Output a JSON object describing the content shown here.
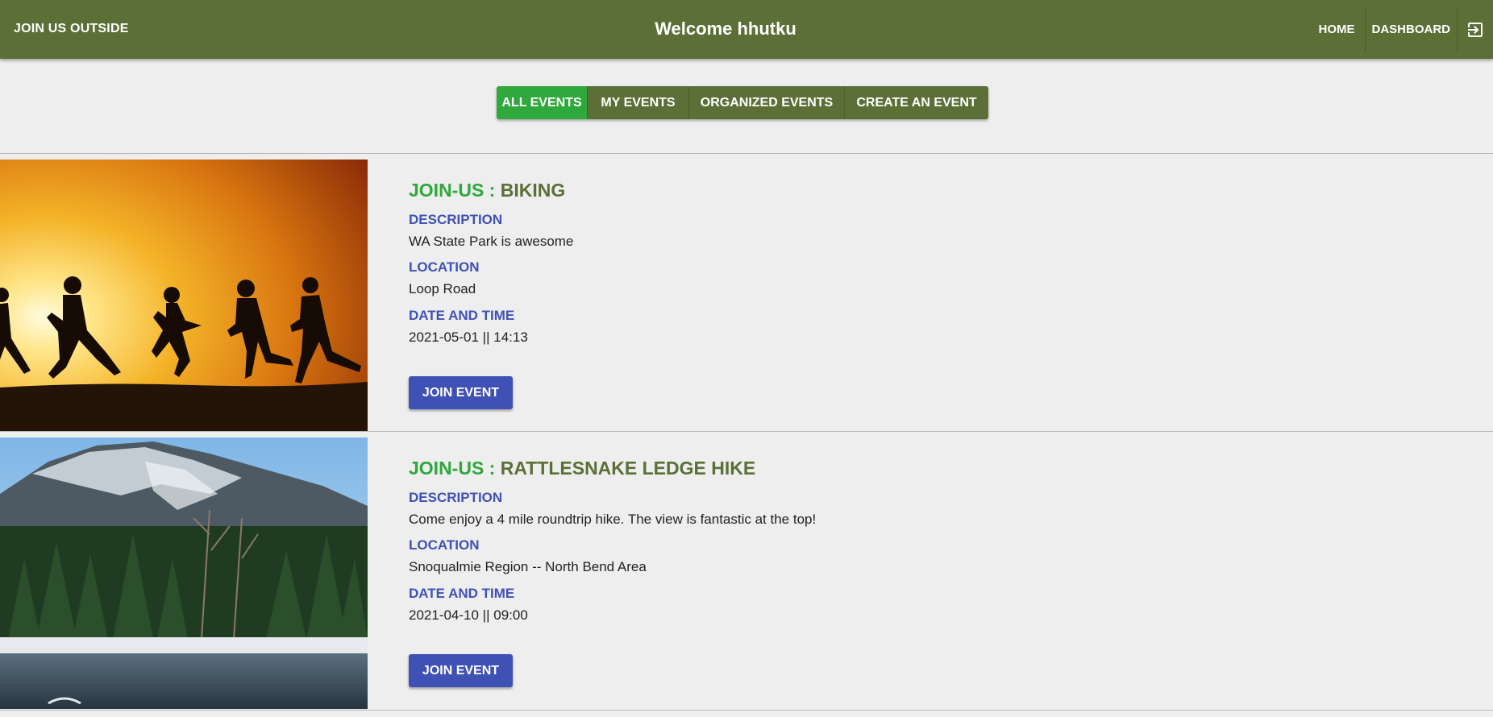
{
  "header": {
    "brand": "JOIN US OUTSIDE",
    "welcome": "Welcome hhutku",
    "nav": {
      "home": "HOME",
      "dashboard": "DASHBOARD",
      "logout_icon": "logout-icon"
    },
    "color": "#5b6f37"
  },
  "tabs": [
    {
      "label": "ALL EVENTS",
      "active": true
    },
    {
      "label": "MY EVENTS",
      "active": false
    },
    {
      "label": "ORGANIZED EVENTS",
      "active": false
    },
    {
      "label": "CREATE AN EVENT",
      "active": false
    }
  ],
  "labels": {
    "description": "DESCRIPTION",
    "location": "LOCATION",
    "datetime": "DATE AND TIME",
    "join_button": "JOIN EVENT",
    "title_prefix": "JOIN-US : "
  },
  "events": [
    {
      "name": "BIKING",
      "description": "WA State Park is awesome",
      "location": "Loop Road",
      "datetime": "2021-05-01 || 14:13",
      "image": "sunset-runners-silhouette"
    },
    {
      "name": "RATTLESNAKE LEDGE HIKE",
      "description": "Come enjoy a 4 mile roundtrip hike. The view is fantastic at the top!",
      "location": "Snoqualmie Region -- North Bend Area",
      "datetime": "2021-04-10 || 09:00",
      "image": "mountain-forest-lake"
    }
  ],
  "colors": {
    "active_tab": "#2fa83c",
    "label_blue": "#3f51b5",
    "background": "#eeeeee"
  }
}
